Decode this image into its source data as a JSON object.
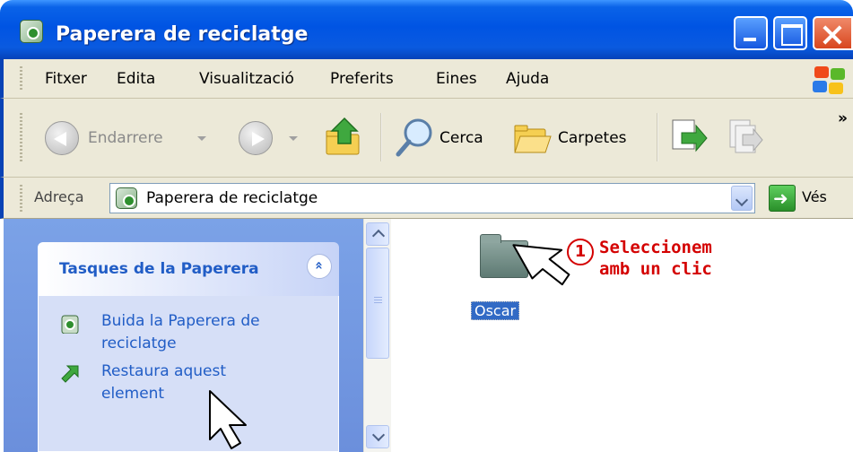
{
  "window": {
    "title": "Paperera de reciclatge",
    "icon": "recycle-bin-icon"
  },
  "menu": {
    "items": [
      "Fitxer",
      "Edita",
      "Visualització",
      "Preferits",
      "Eines",
      "Ajuda"
    ]
  },
  "toolbar": {
    "back_label": "Endarrere",
    "search_label": "Cerca",
    "folders_label": "Carpetes",
    "more_glyph": "»"
  },
  "address": {
    "label": "Adreça",
    "value": "Paperera de reciclatge",
    "go_label": "Vés"
  },
  "tasks": {
    "title": "Tasques de la Paperera",
    "collapse_glyph": "«",
    "links": [
      {
        "label": "Buida la Paperera de reciclatge",
        "icon": "empty-recycle-bin-icon"
      },
      {
        "label": "Restaura aquest element",
        "icon": "restore-icon"
      }
    ]
  },
  "files": [
    {
      "name": "Oscar",
      "icon": "folder-icon",
      "selected": true
    }
  ],
  "annotation": {
    "number": "1",
    "line1": "Seleccionem",
    "line2": "amb un clic",
    "color": "#d40000"
  },
  "colors": {
    "titlebar": "#0054e3",
    "selection": "#316ac5",
    "task_link": "#215dc6",
    "task_pane": "#6b8fdc"
  }
}
